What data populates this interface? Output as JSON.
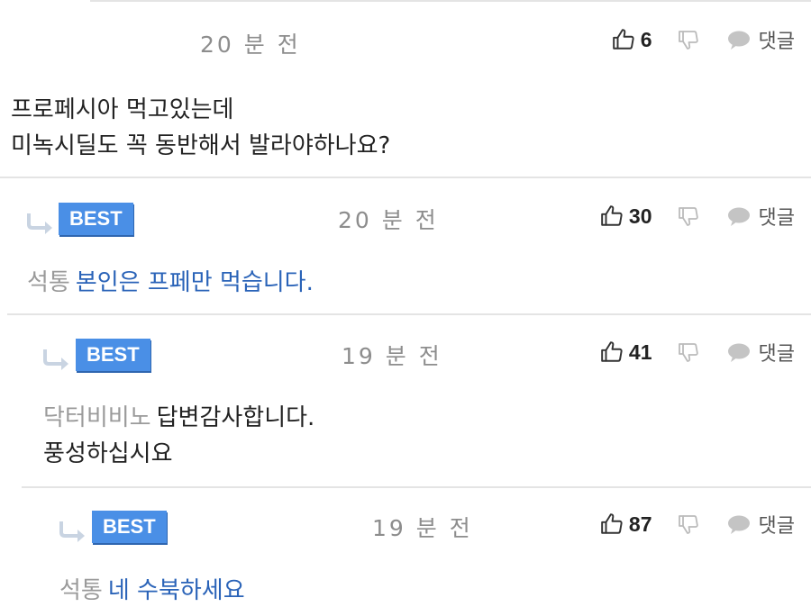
{
  "comments": [
    {
      "time": "20 분 전",
      "likes": "6",
      "reply_label": "댓글",
      "text_lines": [
        "프로페시아 먹고있는데",
        "미녹시딜도 꼭 동반해서 발라야하나요?"
      ]
    },
    {
      "badge": "BEST",
      "time": "20 분 전",
      "likes": "30",
      "reply_label": "댓글",
      "author": "석통",
      "text": "본인은 프페만 먹습니다."
    },
    {
      "badge": "BEST",
      "time": "19 분 전",
      "likes": "41",
      "reply_label": "댓글",
      "author": "닥터비비노",
      "text": "답변감사합니다.",
      "text2": "풍성하십시요"
    },
    {
      "badge": "BEST",
      "time": "19 분 전",
      "likes": "87",
      "reply_label": "댓글",
      "author": "석통",
      "text": "네 수북하세요"
    }
  ],
  "colors": {
    "badge": "#4a8fe6",
    "reply_text_blue": "#2a63b8",
    "muted": "#8d8d8d"
  },
  "icons": [
    "thumbs-up-icon",
    "thumbs-down-icon",
    "speech-bubble-icon",
    "reply-arrow-icon"
  ]
}
